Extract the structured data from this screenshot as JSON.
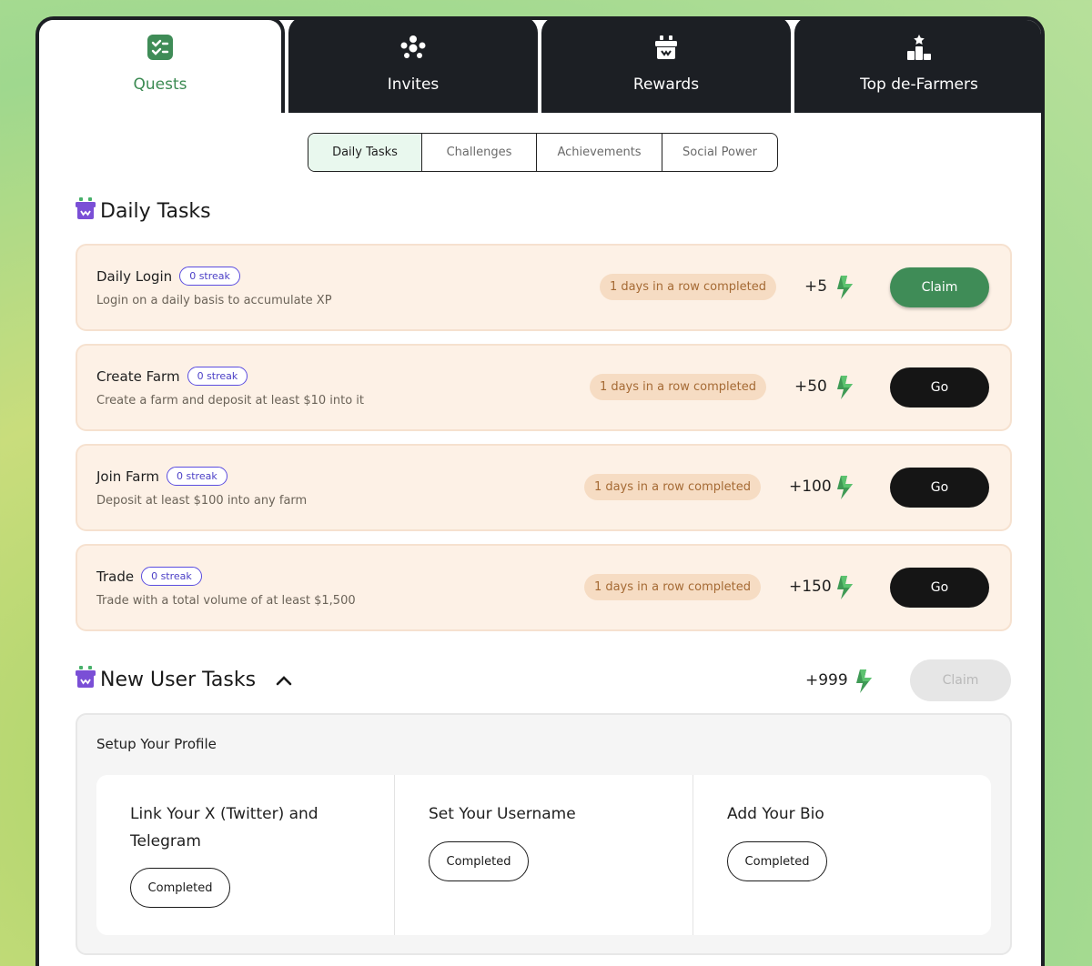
{
  "tabs": [
    {
      "label": "Quests",
      "icon": "checklist-icon",
      "active": true
    },
    {
      "label": "Invites",
      "icon": "people-icon",
      "active": false
    },
    {
      "label": "Rewards",
      "icon": "gift-icon",
      "active": false
    },
    {
      "label": "Top de-Farmers",
      "icon": "podium-icon",
      "active": false
    }
  ],
  "subtabs": [
    {
      "label": "Daily Tasks",
      "active": true
    },
    {
      "label": "Challenges",
      "active": false
    },
    {
      "label": "Achievements",
      "active": false
    },
    {
      "label": "Social Power",
      "active": false
    }
  ],
  "daily": {
    "title": "Daily Tasks",
    "tasks": [
      {
        "name": "Daily Login",
        "streak": "0 streak",
        "desc": "Login on a daily basis to accumulate XP",
        "status": "1 days in a row completed",
        "points": "+5",
        "action": "Claim"
      },
      {
        "name": "Create Farm",
        "streak": "0 streak",
        "desc": "Create a farm and deposit at least $10 into it",
        "status": "1 days in a row completed",
        "points": "+50",
        "action": "Go"
      },
      {
        "name": "Join Farm",
        "streak": "0 streak",
        "desc": "Deposit at least $100 into any farm",
        "status": "1 days in a row completed",
        "points": "+100",
        "action": "Go"
      },
      {
        "name": "Trade",
        "streak": "0 streak",
        "desc": "Trade with a total volume of at least $1,500",
        "status": "1 days in a row completed",
        "points": "+150",
        "action": "Go"
      }
    ]
  },
  "new_user": {
    "title": "New User Tasks",
    "points": "+999",
    "claim_label": "Claim",
    "panel_title": "Setup Your Profile",
    "items": [
      {
        "title": "Link Your X (Twitter) and Telegram",
        "status": "Completed"
      },
      {
        "title": "Set Your Username",
        "status": "Completed"
      },
      {
        "title": "Add Your Bio",
        "status": "Completed"
      }
    ]
  },
  "colors": {
    "accent_green": "#3f8c57",
    "dark": "#1c1f24",
    "task_bg": "#fdf1e6",
    "streak_purple": "#5b4de0",
    "gift_purple": "#7a4fd6"
  }
}
